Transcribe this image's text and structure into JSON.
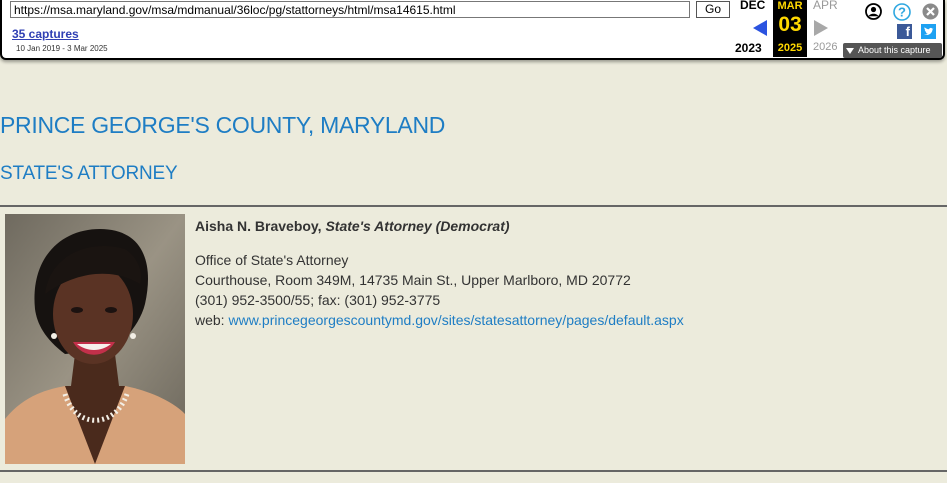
{
  "wayback": {
    "url": "https://msa.maryland.gov/msa/mdmanual/36loc/pg/stattorneys/html/msa14615.html",
    "go_label": "Go",
    "captures_label": "35 captures",
    "date_range": "10 Jan 2019 - 3 Mar 2025",
    "prev_month": "DEC",
    "prev_year": "2023",
    "current_month": "MAR",
    "current_day": "03",
    "current_year": "2025",
    "next_month": "APR",
    "next_year": "2026",
    "about_label": "About this capture",
    "icons": [
      "user-icon",
      "help-icon",
      "close-icon",
      "facebook-icon",
      "twitter-icon"
    ]
  },
  "page": {
    "county_title": "PRINCE GEORGE'S COUNTY, MARYLAND",
    "office_title": "STATE'S ATTORNEY"
  },
  "official": {
    "name": "Aisha N. Braveboy,",
    "role": "State's Attorney (Democrat)",
    "office": "Office of State's Attorney",
    "address": "Courthouse, Room 349M, 14735 Main St., Upper Marlboro, MD 20772",
    "phone": "(301) 952-3500/55; fax: (301) 952-3775",
    "web_label": "web:",
    "web_url": "www.princegeorgescountymd.gov/sites/statesattorney/pages/default.aspx"
  },
  "colors": {
    "background": "#ecebdc",
    "heading": "#1e7dc4",
    "link": "#1e7dc4",
    "calendar_highlight": "#ffd800"
  }
}
